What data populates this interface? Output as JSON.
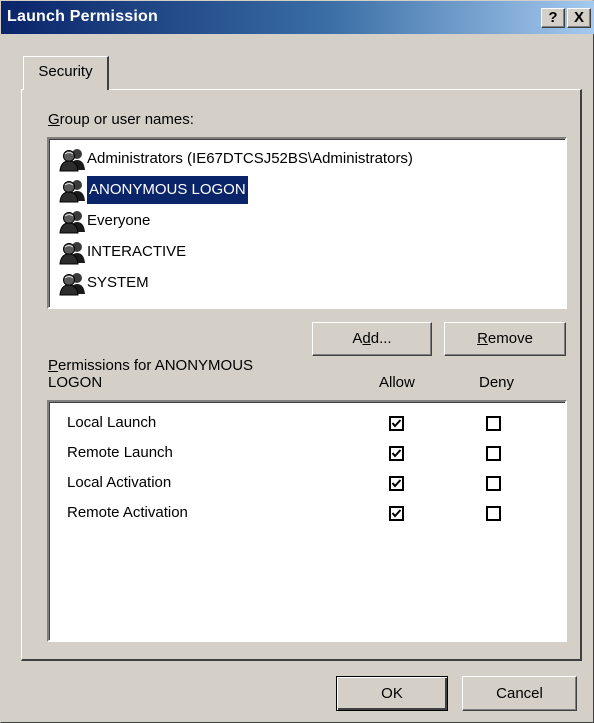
{
  "window": {
    "title": "Launch Permission",
    "help_button": "?",
    "close_button": "X"
  },
  "tabs": [
    {
      "label": "Security"
    }
  ],
  "groups": {
    "label_access": "G",
    "label_rest": "roup or user names:",
    "items": [
      {
        "name": "Administrators (IE67DTCSJ52BS\\Administrators)",
        "icon": "user-group-icon",
        "selected": false
      },
      {
        "name": "ANONYMOUS LOGON",
        "icon": "user-group-icon",
        "selected": true
      },
      {
        "name": "Everyone",
        "icon": "user-group-icon",
        "selected": false
      },
      {
        "name": "INTERACTIVE",
        "icon": "user-group-icon",
        "selected": false
      },
      {
        "name": "SYSTEM",
        "icon": "user-group-icon",
        "selected": false
      }
    ]
  },
  "buttons": {
    "add_pre": "A",
    "add_access": "d",
    "add_post": "d...",
    "remove_access": "R",
    "remove_post": "emove",
    "ok": "OK",
    "cancel": "Cancel"
  },
  "permissions": {
    "header_access": "P",
    "header_line1_rest": "ermissions for ANONYMOUS",
    "header_line2": "LOGON",
    "allow_label": "Allow",
    "deny_label": "Deny",
    "rows": [
      {
        "name": "Local Launch",
        "allow": true,
        "deny": false
      },
      {
        "name": "Remote Launch",
        "allow": true,
        "deny": false
      },
      {
        "name": "Local Activation",
        "allow": true,
        "deny": false
      },
      {
        "name": "Remote Activation",
        "allow": true,
        "deny": false
      }
    ]
  },
  "colors": {
    "dialog_face": "#d4d0c8",
    "title_gradient_start": "#0a246a",
    "title_gradient_end": "#a6caf0",
    "selection": "#0a246a"
  }
}
